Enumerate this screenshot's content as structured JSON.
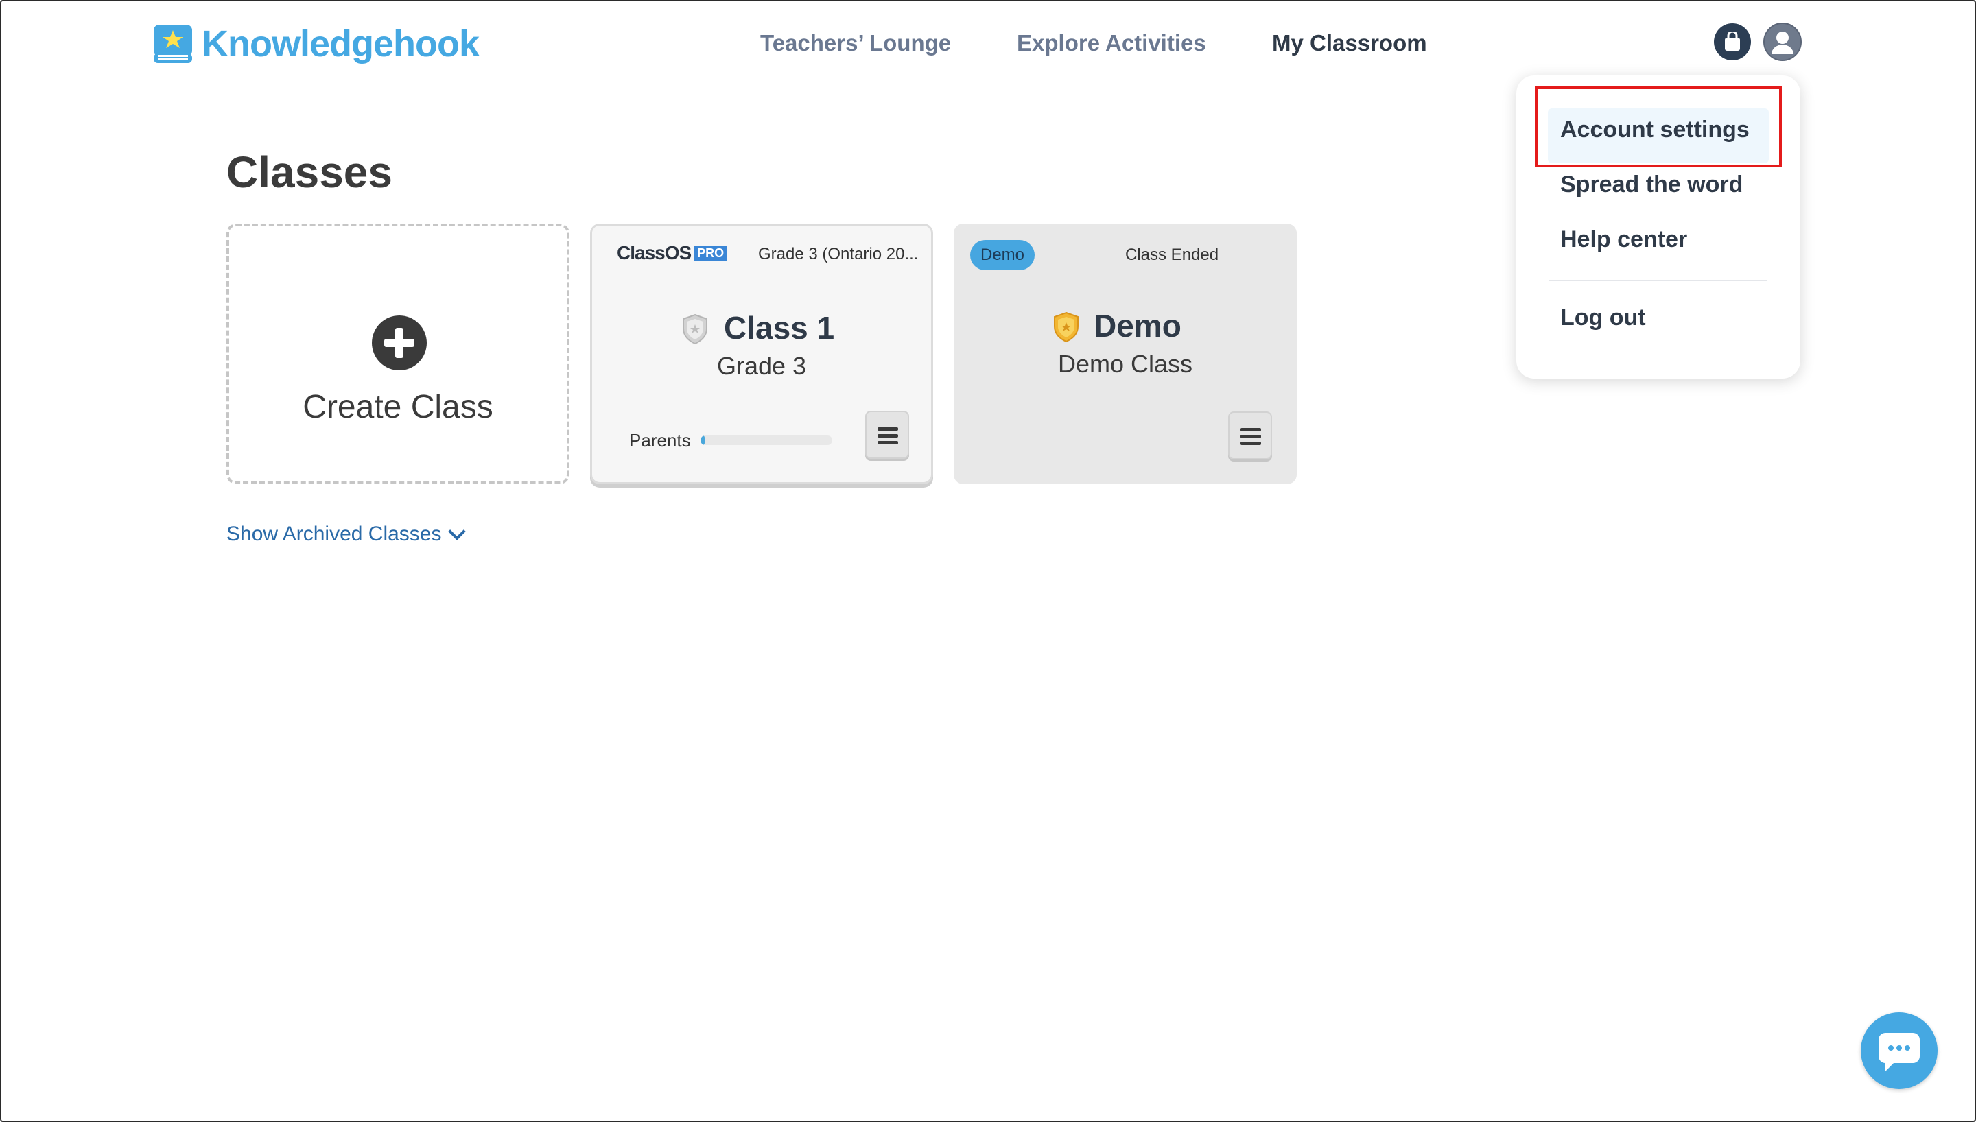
{
  "header": {
    "logo_text": "Knowledgehook",
    "nav": [
      "Teachers’ Lounge",
      "Explore Activities",
      "My Classroom"
    ],
    "active_nav": "My Classroom"
  },
  "dropdown": {
    "items": [
      "Account settings",
      "Spread the word",
      "Help center",
      "Log out"
    ],
    "highlighted": "Account settings"
  },
  "main": {
    "title": "Classes",
    "create_label": "Create Class",
    "classes": [
      {
        "brand": "ClassOS",
        "brand_badge": "PRO",
        "grade_label": "Grade 3 (Ontario 20...",
        "name": "Class 1",
        "subtitle": "Grade 3",
        "parents_label": "Parents",
        "parents_progress": 0.03,
        "shield_color": "#c8c8c8"
      },
      {
        "badge": "Demo",
        "status": "Class Ended",
        "name": "Demo",
        "subtitle": "Demo Class",
        "shield_color": "#f2b632"
      }
    ],
    "archived_toggle": "Show Archived Classes"
  },
  "colors": {
    "brand_blue": "#45a8e2",
    "highlight_red": "#e41b1b",
    "text_dark": "#2f3a48"
  }
}
